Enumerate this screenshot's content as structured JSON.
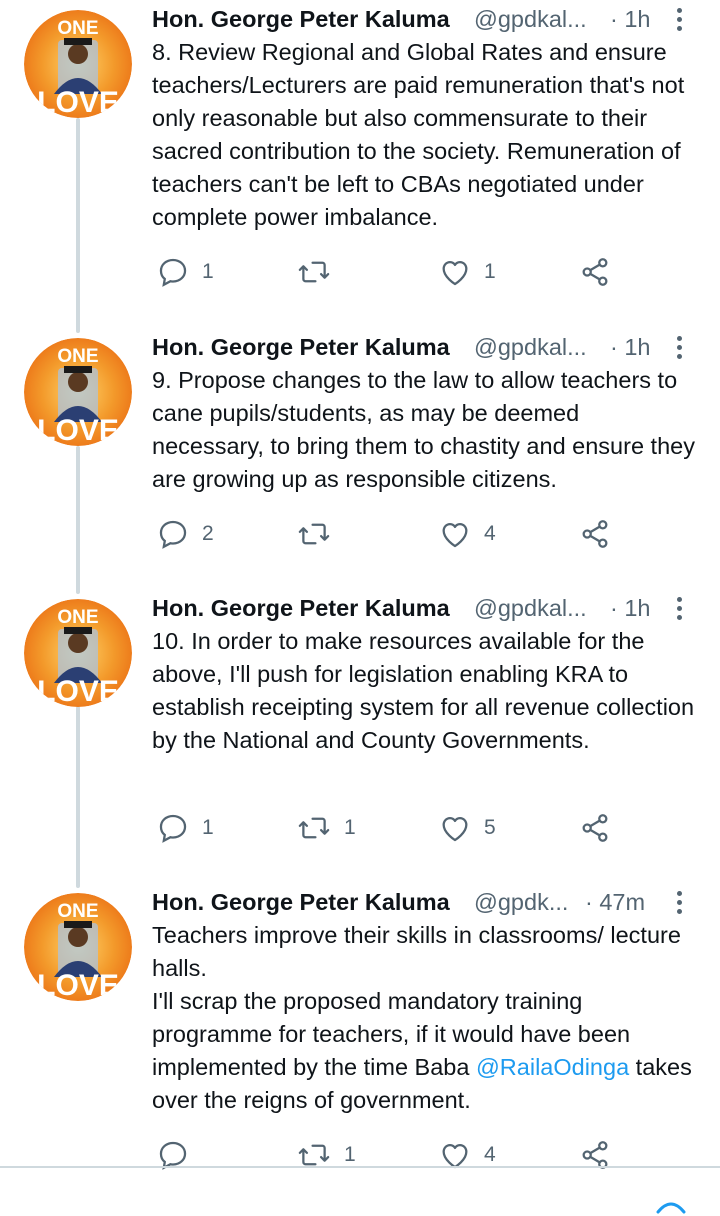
{
  "colors": {
    "text": "#0f1419",
    "secondary": "#536471",
    "link": "#1d9bf0",
    "thread_line": "#cfd9de",
    "avatar_bg": "#f07a1e"
  },
  "avatar": {
    "top_text": "ONE",
    "bottom_text": "LOVE"
  },
  "tweets": [
    {
      "name": "Hon. George Peter Kaluma",
      "handle": "@gpdkal...",
      "time": "· 1h",
      "lines": [
        "8. Review Regional and Global Rates and ensure teachers/Lecturers are paid remuneration that's not only reasonable but also commensurate to their sacred contribution to the society. Remuneration of teachers can't be left to CBAs negotiated under complete power imbalance."
      ],
      "replies": "1",
      "retweets": "",
      "likes": "1"
    },
    {
      "name": "Hon. George Peter Kaluma",
      "handle": "@gpdkal...",
      "time": "· 1h",
      "lines": [
        "9. Propose changes to the law to allow teachers to cane pupils/students, as may be deemed necessary, to bring them to chastity and ensure they are growing up as responsible citizens."
      ],
      "replies": "2",
      "retweets": "",
      "likes": "4"
    },
    {
      "name": "Hon. George Peter Kaluma",
      "handle": "@gpdkal...",
      "time": "· 1h",
      "lines": [
        "10. In order to make resources available for the above, I'll push for legislation enabling KRA to establish receipting system for all revenue collection by the National and County Governments."
      ],
      "replies": "1",
      "retweets": "1",
      "likes": "5"
    },
    {
      "name": "Hon. George Peter Kaluma",
      "handle": "@gpdk...",
      "time": "· 47m",
      "lines": [
        "Teachers improve their skills in classrooms/ lecture halls.",
        "I'll scrap the proposed mandatory training programme for teachers, if it would have been implemented by the time Baba "
      ],
      "mention": "@RailaOdinga",
      "after_mention": " takes over the reigns of government.",
      "replies": "",
      "retweets": "1",
      "likes": "4"
    }
  ]
}
